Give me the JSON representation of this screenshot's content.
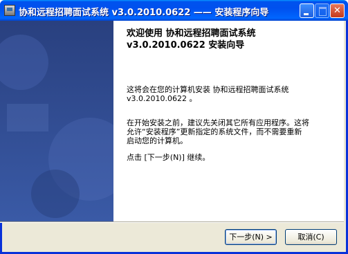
{
  "window": {
    "title": "协和远程招聘面试系统 v3.0.2010.0622 —— 安装程序向导"
  },
  "content": {
    "heading_line1": "欢迎使用 协和远程招聘面试系统",
    "heading_line2": "v3.0.2010.0622 安装向导",
    "para1_line1": "这将会在您的计算机安装 协和远程招聘面试系统",
    "para1_line2": "v3.0.2010.0622 。",
    "para2_line1": "在开始安装之前，建议先关闭其它所有应用程序。这将",
    "para2_line2": "允许“安装程序”更新指定的系统文件，而不需要重新",
    "para2_line3": "启动您的计算机。",
    "para3": "点击 [下一步(N)] 继续。"
  },
  "buttons": {
    "next_label": "下一步(N) >",
    "cancel_label": "取消(C)"
  },
  "colors": {
    "sidebar": "#2f4a8f",
    "titlebar": "#0054e3"
  }
}
